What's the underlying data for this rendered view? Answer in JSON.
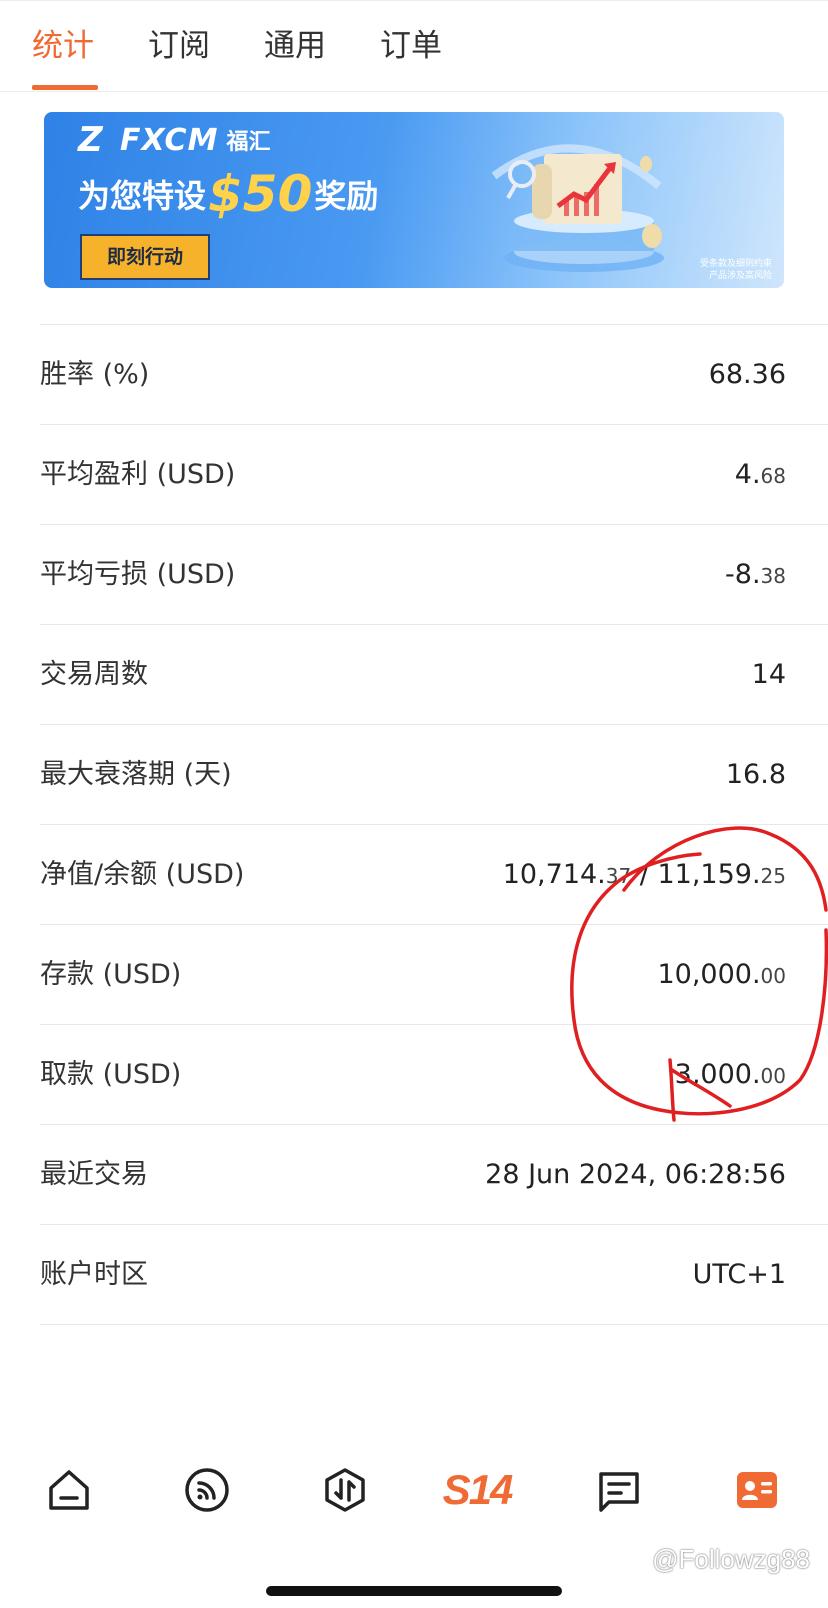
{
  "tabs": [
    {
      "label": "统计",
      "active": true
    },
    {
      "label": "订阅",
      "active": false
    },
    {
      "label": "通用",
      "active": false
    },
    {
      "label": "订单",
      "active": false
    }
  ],
  "banner": {
    "brand": "FXCM",
    "brand_cn": "福汇",
    "headline_pre": "为您特设",
    "headline_amount": "$50",
    "headline_post": "奖励",
    "cta_label": "即刻行动",
    "disclaimer_line1": "受条款及细则约束",
    "disclaimer_line2": "产品涉及高风险"
  },
  "stats": [
    {
      "label": "胜率 (%)",
      "value": "68.36",
      "dec": ""
    },
    {
      "label": "平均盈利 (USD)",
      "value": "4.",
      "dec": "68"
    },
    {
      "label": "平均亏损 (USD)",
      "value": "-8.",
      "dec": "38"
    },
    {
      "label": "交易周数",
      "value": "14",
      "dec": ""
    },
    {
      "label": "最大衰落期 (天)",
      "value": "16.8",
      "dec": ""
    },
    {
      "label": "净值/余额 (USD)",
      "value": "10,714.",
      "dec": "37",
      "value2": " / 11,159.",
      "dec2": "25"
    },
    {
      "label": "存款 (USD)",
      "value": "10,000.",
      "dec": "00"
    },
    {
      "label": "取款 (USD)",
      "value": "3,000.",
      "dec": "00"
    },
    {
      "label": "最近交易",
      "value": "28 Jun 2024, 06:28:56",
      "dec": ""
    },
    {
      "label": "账户时区",
      "value": "UTC+1",
      "dec": ""
    }
  ],
  "bottom_nav": {
    "s14_label": "S14",
    "icons": [
      "home-icon",
      "feed-icon",
      "trade-icon",
      "s14-logo",
      "messages-icon",
      "profile-card-icon"
    ]
  },
  "watermark": "@Followzg88",
  "colors": {
    "accent": "#ef6b33",
    "annotation": "#e02020"
  }
}
